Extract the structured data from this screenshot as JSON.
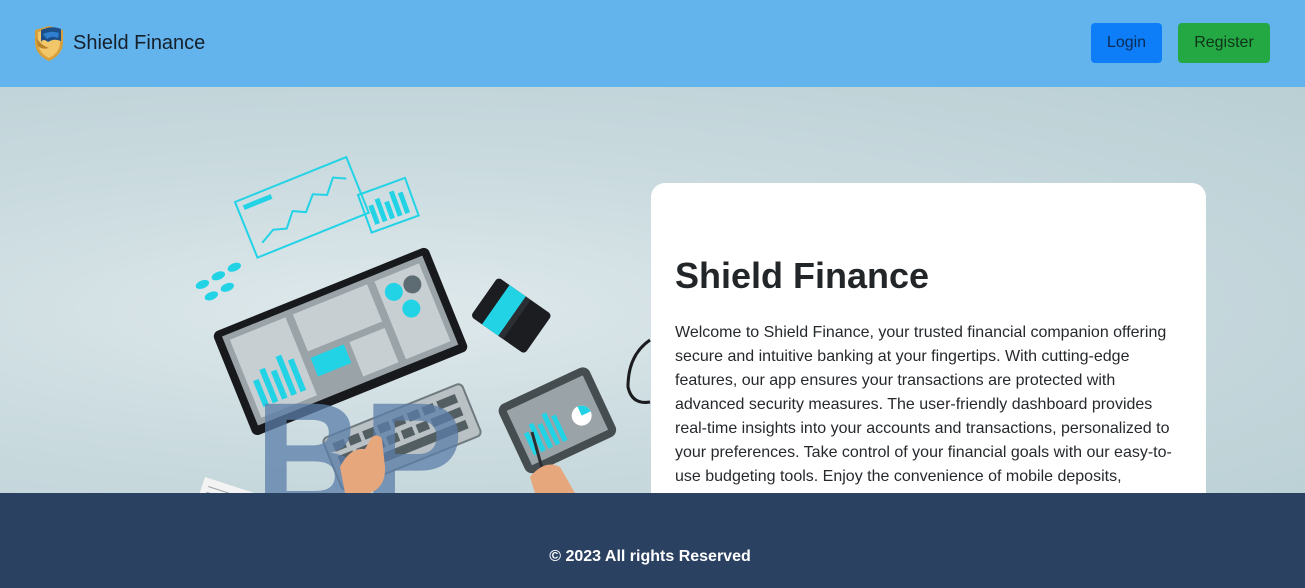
{
  "navbar": {
    "brand_name": "Shield Finance",
    "login_label": "Login",
    "register_label": "Register"
  },
  "hero": {
    "title": "Shield Finance",
    "description": "Welcome to Shield Finance, your trusted financial companion offering secure and intuitive banking at your fingertips. With cutting-edge features, our app ensures your transactions are protected with advanced security measures. The user-friendly dashboard provides real-time insights into your accounts and transactions, personalized to your preferences. Take control of your financial goals with our easy-to-use budgeting tools. Enjoy the convenience of mobile deposits,"
  },
  "footer": {
    "copyright": "© 2023 All rights Reserved"
  },
  "colors": {
    "navbar_bg": "#63b3ec",
    "login_bg": "#0d7ef7",
    "register_bg": "#24a844",
    "footer_bg": "#2b4162",
    "accent_cyan": "#22d3e6"
  },
  "icons": {
    "brand_logo": "shield-eagle-logo"
  }
}
